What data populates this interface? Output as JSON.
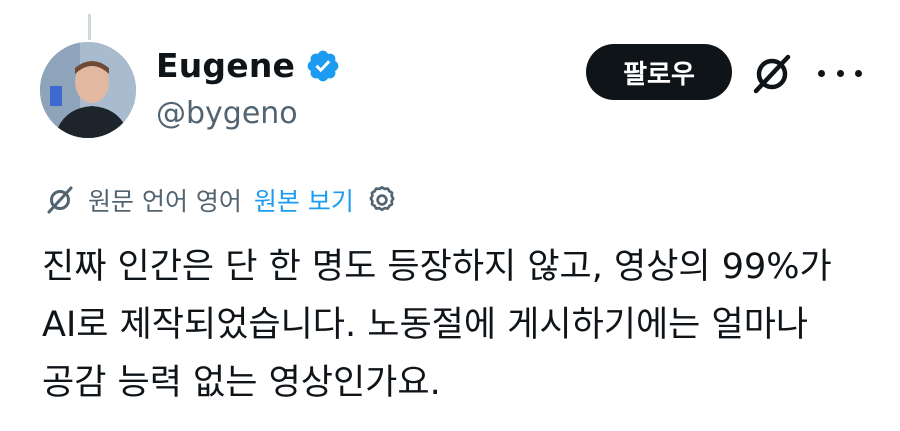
{
  "user": {
    "display_name": "Eugene",
    "handle": "@bygeno",
    "verified": true
  },
  "actions": {
    "follow_label": "팔로우",
    "grok_icon": "grok-slash-icon",
    "more_icon": "more-horizontal-icon"
  },
  "translation": {
    "icon": "grok-translate-icon",
    "label": "원문 언어 영어",
    "link": "원본 보기",
    "settings_icon": "gear-icon"
  },
  "tweet": {
    "lines": [
      "진짜 인간은 단 한 명도 등장하지 않고, 영상의 99%가",
      "AI로 제작되었습니다. 노동절에 게시하기에는 얼마나",
      "공감 능력 없는 영상인가요."
    ]
  },
  "colors": {
    "text": "#0f1419",
    "secondary": "#536471",
    "link": "#1d9bf0",
    "verified_badge": "#1d9bf0",
    "button_bg": "#0f1419"
  }
}
